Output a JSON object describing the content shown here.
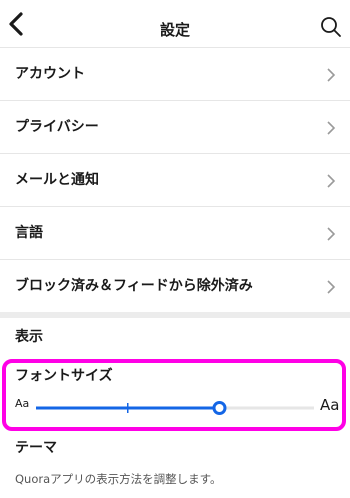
{
  "header": {
    "title": "設定",
    "back_icon": "chevron-left-icon",
    "search_icon": "search-icon"
  },
  "menu": [
    {
      "label": "アカウント"
    },
    {
      "label": "プライバシー"
    },
    {
      "label": "メールと通知"
    },
    {
      "label": "言語"
    },
    {
      "label": "ブロック済み＆フィードから除外済み"
    }
  ],
  "display": {
    "section_title": "表示",
    "font_size": {
      "title": "フォントサイズ",
      "small_label": "Aa",
      "large_label": "Aa",
      "value_fraction": 0.66,
      "tick_fraction": 0.33
    },
    "theme": {
      "title": "テーマ",
      "description": "Quoraアプリの表示方法を調整します。"
    }
  },
  "colors": {
    "accent": "#1466e6",
    "highlight": "#ff00e6",
    "track": "#e6e6e6",
    "divider": "#ececec"
  }
}
